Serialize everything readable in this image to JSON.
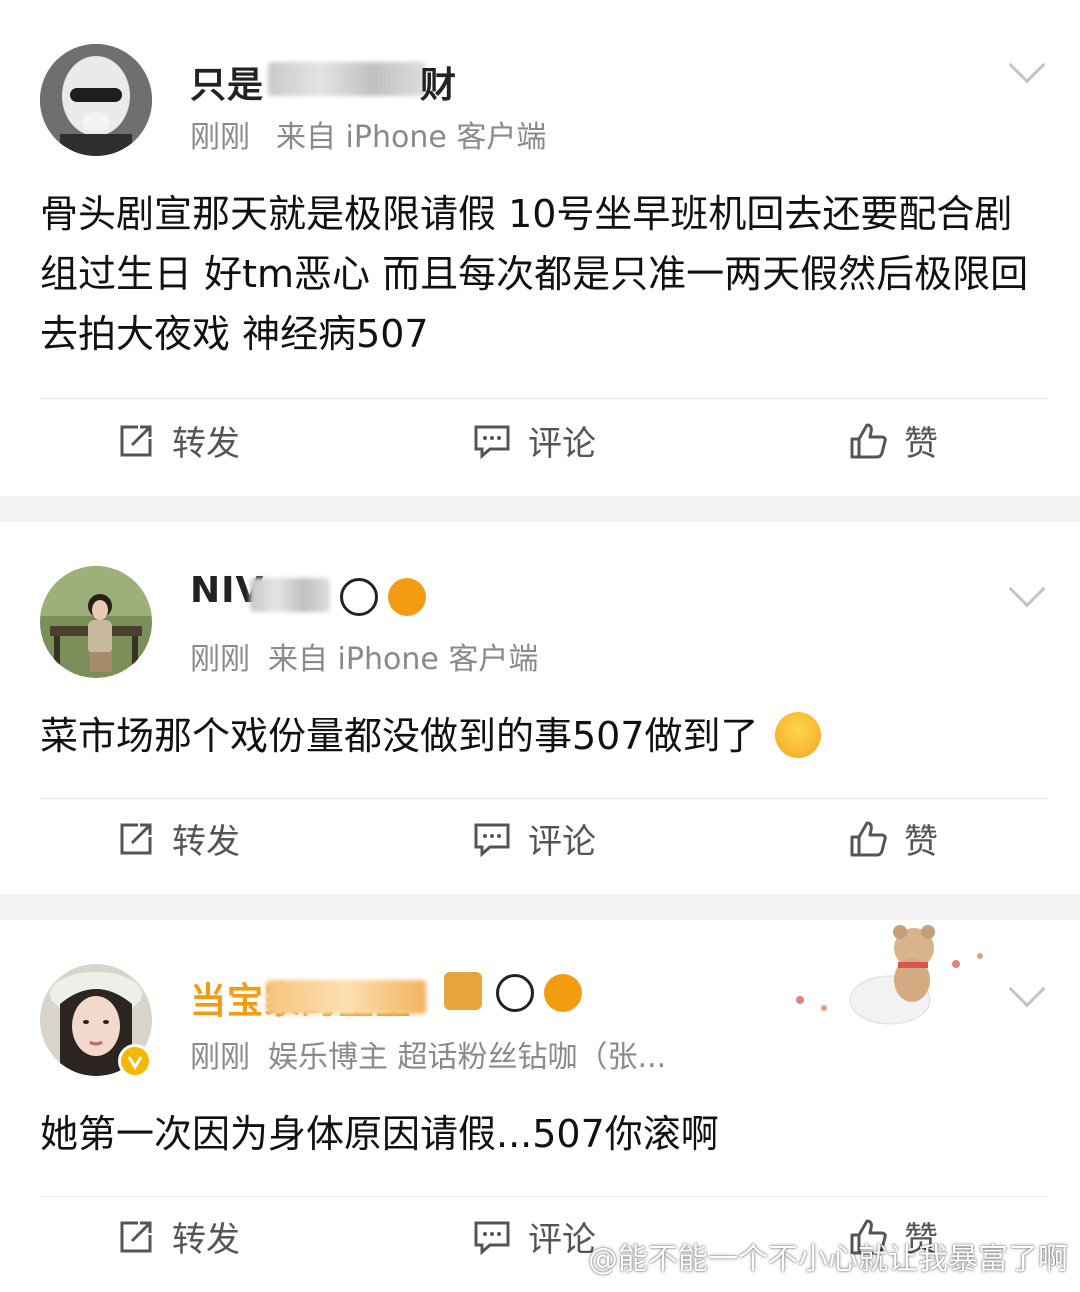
{
  "posts": [
    {
      "username": "只是",
      "username_tail": "财",
      "time": "刚刚",
      "source": "来自 iPhone 客户端",
      "content": "骨头剧宣那天就是极限请假 10号坐早班机回去还要配合剧组过生日 好tm恶心 而且每次都是只准一两天假然后极限回去拍大夜戏 神经病507",
      "actions": {
        "repost": "转发",
        "comment": "评论",
        "like": "赞"
      }
    },
    {
      "username": "NIV",
      "time": "刚刚",
      "source": "来自 iPhone 客户端",
      "content": "菜市场那个戏份量都没做到的事507做到了",
      "actions": {
        "repost": "转发",
        "comment": "评论",
        "like": "赞"
      }
    },
    {
      "username": "当宝家的星星",
      "time": "刚刚",
      "source": "娱乐博主 超话粉丝钻咖（张...",
      "content": "她第一次因为身体原因请假...507你滚啊",
      "actions": {
        "repost": "转发",
        "comment": "评论",
        "like": "赞"
      }
    }
  ],
  "watermark": "@能不能一个不小心就让我暴富了啊",
  "icons": [
    "repost-icon",
    "comment-icon",
    "like-icon",
    "chevron-down-icon",
    "verified-icon",
    "panda-icon",
    "pufferfish-icon",
    "crying-emoji-icon"
  ],
  "colors": {
    "accent_orange": "#f39c12",
    "gold": "#f5b800",
    "text": "#111111",
    "meta": "#8a8a8a"
  }
}
